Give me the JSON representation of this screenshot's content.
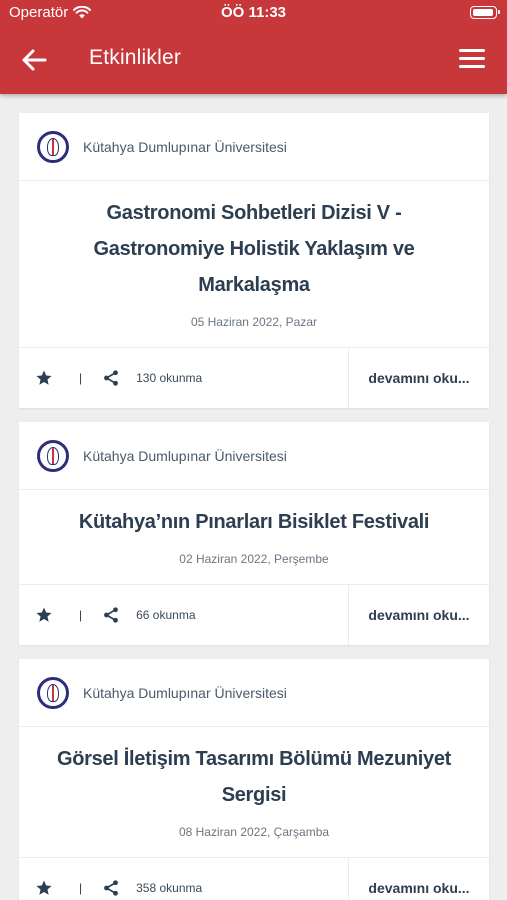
{
  "status": {
    "carrier": "Operatör",
    "time": "ÖÖ 11:33"
  },
  "appbar": {
    "title": "Etkinlikler"
  },
  "colors": {
    "header": "#c8373a",
    "text": "#2c3e50"
  },
  "events": [
    {
      "org": "Kütahya Dumlupınar Üniversitesi",
      "title": "Gastronomi Sohbetleri Dizisi V - Gastronomiye Holistik Yaklaşım ve Markalaşma",
      "date": "05 Haziran 2022, Pazar",
      "separator": "|",
      "reads": "130 okunma",
      "more": "devamını oku..."
    },
    {
      "org": "Kütahya Dumlupınar Üniversitesi",
      "title": "Kütahya’nın Pınarları Bisiklet Festivali",
      "date": "02 Haziran 2022, Perşembe",
      "separator": "|",
      "reads": "66 okunma",
      "more": "devamını oku..."
    },
    {
      "org": "Kütahya Dumlupınar Üniversitesi",
      "title": "Görsel İletişim Tasarımı Bölümü Mezuniyet Sergisi",
      "date": "08 Haziran 2022, Çarşamba",
      "separator": "|",
      "reads": "358 okunma",
      "more": "devamını oku..."
    }
  ]
}
